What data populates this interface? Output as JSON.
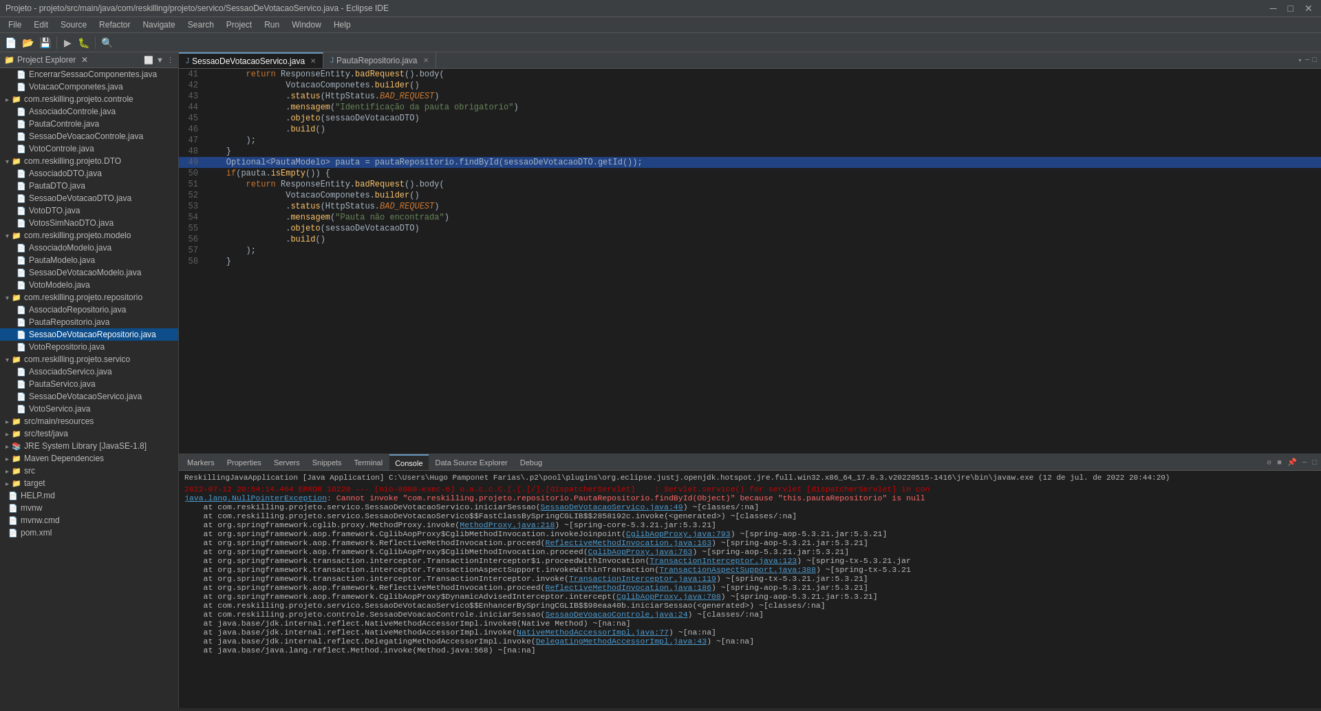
{
  "titleBar": {
    "title": "Projeto - projeto/src/main/java/com/reskilling/projeto/servico/SessaoDeVotacaoServico.java - Eclipse IDE",
    "minimize": "─",
    "maximize": "□",
    "close": "✕"
  },
  "menuBar": {
    "items": [
      "File",
      "Edit",
      "Source",
      "Refactor",
      "Navigate",
      "Search",
      "Project",
      "Run",
      "Window",
      "Help"
    ]
  },
  "projectExplorer": {
    "title": "Project Explorer",
    "items": [
      {
        "level": 1,
        "type": "file",
        "label": "EncerrarSessaoComponentes.java",
        "arrow": ""
      },
      {
        "level": 1,
        "type": "file",
        "label": "VotacaoComponetes.java",
        "arrow": ""
      },
      {
        "level": 0,
        "type": "package",
        "label": "com.reskilling.projeto.controle",
        "arrow": "▸"
      },
      {
        "level": 1,
        "type": "file",
        "label": "AssociadoControle.java",
        "arrow": ""
      },
      {
        "level": 1,
        "type": "file",
        "label": "PautaControle.java",
        "arrow": ""
      },
      {
        "level": 1,
        "type": "file",
        "label": "SessaoDeVoacaoControle.java",
        "arrow": ""
      },
      {
        "level": 1,
        "type": "file",
        "label": "VotoControle.java",
        "arrow": ""
      },
      {
        "level": 0,
        "type": "package",
        "label": "com.reskilling.projeto.DTO",
        "arrow": "▾"
      },
      {
        "level": 1,
        "type": "file",
        "label": "AssociadoDTO.java",
        "arrow": ""
      },
      {
        "level": 1,
        "type": "file",
        "label": "PautaDTO.java",
        "arrow": ""
      },
      {
        "level": 1,
        "type": "file",
        "label": "SessaoDeVotacaoDTO.java",
        "arrow": ""
      },
      {
        "level": 1,
        "type": "file",
        "label": "VotoDTO.java",
        "arrow": ""
      },
      {
        "level": 1,
        "type": "file",
        "label": "VotosSimNaoDTO.java",
        "arrow": ""
      },
      {
        "level": 0,
        "type": "package",
        "label": "com.reskilling.projeto.modelo",
        "arrow": "▾"
      },
      {
        "level": 1,
        "type": "file",
        "label": "AssociadoModelo.java",
        "arrow": ""
      },
      {
        "level": 1,
        "type": "file",
        "label": "PautaModelo.java",
        "arrow": ""
      },
      {
        "level": 1,
        "type": "file",
        "label": "SessaoDeVotacaoModelo.java",
        "arrow": ""
      },
      {
        "level": 1,
        "type": "file",
        "label": "VotoModelo.java",
        "arrow": ""
      },
      {
        "level": 0,
        "type": "package",
        "label": "com.reskilling.projeto.repositorio",
        "arrow": "▾"
      },
      {
        "level": 1,
        "type": "file",
        "label": "AssociadoRepositorio.java",
        "arrow": ""
      },
      {
        "level": 1,
        "type": "file",
        "label": "PautaRepositorio.java",
        "arrow": ""
      },
      {
        "level": 1,
        "type": "file-selected",
        "label": "SessaoDeVotacaoRepositorio.java",
        "arrow": ""
      },
      {
        "level": 1,
        "type": "file",
        "label": "VotoRepositorio.java",
        "arrow": ""
      },
      {
        "level": 0,
        "type": "package",
        "label": "com.reskilling.projeto.servico",
        "arrow": "▾"
      },
      {
        "level": 1,
        "type": "file",
        "label": "AssociadoServico.java",
        "arrow": ""
      },
      {
        "level": 1,
        "type": "file",
        "label": "PautaServico.java",
        "arrow": ""
      },
      {
        "level": 1,
        "type": "file",
        "label": "SessaoDeVotacaoServico.java",
        "arrow": ""
      },
      {
        "level": 1,
        "type": "file",
        "label": "VotoServico.java",
        "arrow": ""
      },
      {
        "level": 0,
        "type": "folder",
        "label": "src/main/resources",
        "arrow": "▸"
      },
      {
        "level": 0,
        "type": "folder",
        "label": "src/test/java",
        "arrow": "▸"
      },
      {
        "level": 0,
        "type": "library",
        "label": "JRE System Library [JavaSE-1.8]",
        "arrow": "▸"
      },
      {
        "level": 0,
        "type": "folder",
        "label": "Maven Dependencies",
        "arrow": "▸"
      },
      {
        "level": 0,
        "type": "folder",
        "label": "src",
        "arrow": "▸"
      },
      {
        "level": 0,
        "type": "folder",
        "label": "target",
        "arrow": "▸"
      },
      {
        "level": 0,
        "type": "file",
        "label": "HELP.md",
        "arrow": ""
      },
      {
        "level": 0,
        "type": "file",
        "label": "mvnw",
        "arrow": ""
      },
      {
        "level": 0,
        "type": "file",
        "label": "mvnw.cmd",
        "arrow": ""
      },
      {
        "level": 0,
        "type": "file",
        "label": "pom.xml",
        "arrow": ""
      }
    ]
  },
  "editorTabs": [
    {
      "label": "SessaoDeVotacaoServico.java",
      "active": true,
      "icon": "J"
    },
    {
      "label": "PautaRepositorio.java",
      "active": false,
      "icon": "J"
    }
  ],
  "codeLines": [
    {
      "num": "41",
      "content": "        return ResponseEntity.<span class='method'>badRequest</span>().body(",
      "highlighted": false
    },
    {
      "num": "42",
      "content": "                VotacaoComponetes.<span class='method'>builder</span>()",
      "highlighted": false
    },
    {
      "num": "43",
      "content": "                .<span class='method'>status</span>(HttpStatus.<span class='italic-bad'>BAD_REQUEST</span>)",
      "highlighted": false
    },
    {
      "num": "44",
      "content": "                .<span class='method'>mensagem</span>(<span class='str'>\"Identificação da pauta obrigatorio\"</span>)",
      "highlighted": false
    },
    {
      "num": "45",
      "content": "                .<span class='method'>objeto</span>(sessaoDeVotacaoDTO)",
      "highlighted": false
    },
    {
      "num": "46",
      "content": "                .<span class='method'>build</span>()",
      "highlighted": false
    },
    {
      "num": "47",
      "content": "        );",
      "highlighted": false
    },
    {
      "num": "48",
      "content": "    }",
      "highlighted": false
    },
    {
      "num": "49",
      "content": "    Optional&lt;PautaModelo&gt; pauta = pautaRepositorio.findById(sessaoDeVotacaoDTO.getId());",
      "highlighted": true
    },
    {
      "num": "50",
      "content": "    if(pauta.isEmpty()) {",
      "highlighted": false
    },
    {
      "num": "51",
      "content": "        return ResponseEntity.<span class='method'>badRequest</span>().body(",
      "highlighted": false
    },
    {
      "num": "52",
      "content": "                VotacaoComponetes.<span class='method'>builder</span>()",
      "highlighted": false
    },
    {
      "num": "53",
      "content": "                .<span class='method'>status</span>(HttpStatus.<span class='italic-bad'>BAD_REQUEST</span>)",
      "highlighted": false
    },
    {
      "num": "54",
      "content": "                .<span class='method'>mensagem</span>(<span class='str'>\"Pauta não encontrada\"</span>)",
      "highlighted": false
    },
    {
      "num": "55",
      "content": "                .<span class='method'>objeto</span>(sessaoDeVotacaoDTO)",
      "highlighted": false
    },
    {
      "num": "56",
      "content": "                .<span class='method'>build</span>()",
      "highlighted": false
    },
    {
      "num": "57",
      "content": "        );",
      "highlighted": false
    },
    {
      "num": "58",
      "content": "    }",
      "highlighted": false
    }
  ],
  "bottomTabs": [
    {
      "label": "Markers",
      "active": false
    },
    {
      "label": "Properties",
      "active": false
    },
    {
      "label": "Servers",
      "active": false
    },
    {
      "label": "Snippets",
      "active": false
    },
    {
      "label": "Terminal",
      "active": false
    },
    {
      "label": "Console",
      "active": true
    },
    {
      "label": "Data Source Explorer",
      "active": false
    },
    {
      "label": "Debug",
      "active": false
    }
  ],
  "console": {
    "header": "ReskillingJavaApplication [Java Application] C:\\Users\\Hugo Pamponet Farias\\.p2\\pool\\plugins\\org.eclipse.justj.openjdk.hotspot.jre.full.win32.x86_64_17.0.3.v20220515-1416\\jre\\bin\\javaw.exe (12 de jul. de 2022 20:44:20)",
    "lines": [
      {
        "type": "error",
        "text": "2022-07-12 20:54:14.464 ERROR 10220 --- [nio-8080-exec-6] o.a.c.c.C.[.[.[/].[dispatcherServlet]    : Servlet.service() for servlet [dispatcherServlet] in con"
      },
      {
        "type": "npe",
        "text": "java.lang.NullPointerException: Cannot invoke \"com.reskilling.projeto.repositorio.PautaRepositorio.findById(Object)\" because \"this.pautaRepositorio\" is null"
      },
      {
        "type": "stack",
        "text": "    at com.reskilling.projeto.servico.SessaoDeVotacaoServico.iniciarSessao(",
        "link": "SessaoDeVotacaoServico.java:49",
        "suffix": ") ~[classes/:na]"
      },
      {
        "type": "stack",
        "text": "    at com.reskilling.projeto.servico.SessaoDeVotacaoServico$$FastClassBySpringCGLIB$$2858192c.invoke(<generated>) ~[classes/:na]"
      },
      {
        "type": "stack",
        "text": "    at org.springframework.cglib.proxy.MethodProxy.invoke(",
        "link": "MethodProxy.java:218",
        "suffix": ") ~[spring-core-5.3.21.jar:5.3.21]"
      },
      {
        "type": "stack",
        "text": "    at org.springframework.aop.framework.CglibAopProxy$CglibMethodInvocation.invokeJoinpoint(",
        "link": "CglibAopProxy.java:793",
        "suffix": ") ~[spring-aop-5.3.21.jar:5.3.21]"
      },
      {
        "type": "stack",
        "text": "    at org.springframework.aop.framework.ReflectiveMethodInvocation.proceed(",
        "link": "ReflectiveMethodInvocation.java:163",
        "suffix": ") ~[spring-aop-5.3.21.jar:5.3.21]"
      },
      {
        "type": "stack",
        "text": "    at org.springframework.aop.framework.CglibAopProxy$CglibMethodInvocation.proceed(",
        "link": "CglibAopProxy.java:763",
        "suffix": ") ~[spring-aop-5.3.21.jar:5.3.21]"
      },
      {
        "type": "stack",
        "text": "    at org.springframework.transaction.interceptor.TransactionInterceptor$1.proceedWithInvocation(",
        "link": "TransactionInterceptor.java:123",
        "suffix": ") ~[spring-tx-5.3.21.jar"
      },
      {
        "type": "stack",
        "text": "    at org.springframework.transaction.interceptor.TransactionAspectSupport.invokeWithinTransaction(",
        "link": "TransactionAspectSupport.java:388",
        "suffix": ") ~[spring-tx-5.3.21"
      },
      {
        "type": "stack",
        "text": "    at org.springframework.transaction.interceptor.TransactionInterceptor.invoke(",
        "link": "TransactionInterceptor.java:119",
        "suffix": ") ~[spring-tx-5.3.21.jar:5.3.21]"
      },
      {
        "type": "stack",
        "text": "    at org.springframework.aop.framework.ReflectiveMethodInvocation.proceed(",
        "link": "ReflectiveMethodInvocation.java:186",
        "suffix": ") ~[spring-aop-5.3.21.jar:5.3.21]"
      },
      {
        "type": "stack",
        "text": "    at org.springframework.aop.framework.CglibAopProxy$DynamicAdvisedInterceptor.intercept(",
        "link": "CglibAopProxy.java:708",
        "suffix": ") ~[spring-aop-5.3.21.jar:5.3.21]"
      },
      {
        "type": "stack",
        "text": "    at com.reskilling.projeto.servico.SessaoDeVotacaoServico$$EnhancerBySpringCGLIB$$98eaa40b.iniciarSessao(<generated>) ~[classes/:na]"
      },
      {
        "type": "stack",
        "text": "    at com.reskilling.projeto.controle.SessaoDeVoacaoControle.iniciarSessao(",
        "link": "SessaoDeVoacaoControle.java:24",
        "suffix": ") ~[classes/:na]"
      },
      {
        "type": "stack",
        "text": "    at java.base/jdk.internal.reflect.NativeMethodAccessorImpl.invoke0(Native Method) ~[na:na]"
      },
      {
        "type": "stack",
        "text": "    at java.base/jdk.internal.reflect.NativeMethodAccessorImpl.invoke(",
        "link": "NativeMethodAccessorImpl.java:77",
        "suffix": ") ~[na:na]"
      },
      {
        "type": "stack",
        "text": "    at java.base/jdk.internal.reflect.DelegatingMethodAccessorImpl.invoke(",
        "link": "DelegatingMethodAccessorImpl.java:43",
        "suffix": ") ~[na:na]"
      },
      {
        "type": "stack",
        "text": "    at java.base/java.lang.reflect.Method.invoke(Method.java:568) ~[na:na]"
      }
    ]
  }
}
